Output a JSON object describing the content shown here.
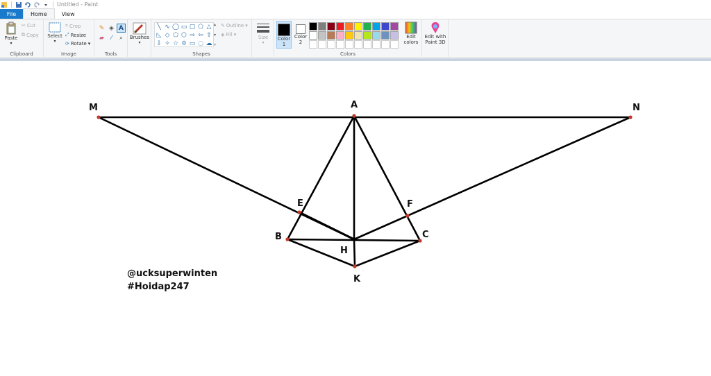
{
  "window": {
    "title": "Untitled - Paint"
  },
  "tabs": [
    {
      "label": "File"
    },
    {
      "label": "Home"
    },
    {
      "label": "View"
    }
  ],
  "ribbon": {
    "clipboard": {
      "group_label": "Clipboard",
      "paste": "Paste",
      "cut": "Cut",
      "copy": "Copy"
    },
    "image": {
      "group_label": "Image",
      "select": "Select",
      "crop": "Crop",
      "resize": "Resize",
      "rotate": "Rotate"
    },
    "tools": {
      "group_label": "Tools"
    },
    "brushes": {
      "label": "Brushes"
    },
    "shapes": {
      "group_label": "Shapes",
      "outline": "Outline",
      "fill": "Fill"
    },
    "size": {
      "label": "Size"
    },
    "colors": {
      "group_label": "Colors",
      "color1": "Color 1",
      "color1_value": "#000000",
      "color2": "Color 2",
      "color2_value": "#ffffff",
      "edit_colors": "Edit colors",
      "palette_row1": [
        "#000000",
        "#7f7f7f",
        "#880015",
        "#ed1c24",
        "#ff7f27",
        "#fff200",
        "#22b14c",
        "#00a2e8",
        "#3f48cc",
        "#a349a4"
      ],
      "palette_row2": [
        "#ffffff",
        "#c3c3c3",
        "#b97a57",
        "#ffaec9",
        "#ffc90e",
        "#efe4b0",
        "#b5e61d",
        "#99d9ea",
        "#7092be",
        "#c8bfe7"
      ],
      "palette_row3": [
        "#ffffff",
        "#ffffff",
        "#ffffff",
        "#ffffff",
        "#ffffff",
        "#ffffff",
        "#ffffff",
        "#ffffff",
        "#ffffff",
        "#ffffff"
      ]
    },
    "paint3d": {
      "label": "Edit with Paint 3D"
    }
  },
  "drawing": {
    "points": [
      {
        "name": "M"
      },
      {
        "name": "A"
      },
      {
        "name": "N"
      },
      {
        "name": "E"
      },
      {
        "name": "F"
      },
      {
        "name": "B"
      },
      {
        "name": "C"
      },
      {
        "name": "H"
      },
      {
        "name": "K"
      }
    ],
    "watermark_line1": "@ucksuperwinten",
    "watermark_line2": "#Hoidap247",
    "stroke_color": "#000000",
    "vertex_color": "#c0392b"
  }
}
